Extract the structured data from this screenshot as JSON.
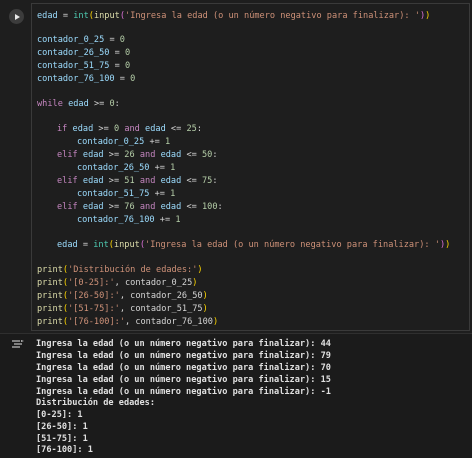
{
  "code": {
    "line1": {
      "var": "edad",
      "eq": " = ",
      "int": "int",
      "input": "input",
      "prompt": "'Ingresa la edad (o un número negativo para finalizar): '"
    },
    "counters": [
      {
        "name": "contador_0_25",
        "eq": " = ",
        "val": "0"
      },
      {
        "name": "contador_26_50",
        "eq": " = ",
        "val": "0"
      },
      {
        "name": "contador_51_75",
        "eq": " = ",
        "val": "0"
      },
      {
        "name": "contador_76_100",
        "eq": " = ",
        "val": "0"
      }
    ],
    "while": {
      "kw": "while",
      "var": "edad",
      "op": " >= ",
      "val": "0",
      "colon": ":"
    },
    "branches": [
      {
        "kw": "if",
        "var1": "edad",
        "op1": " >= ",
        "lo": "0",
        "and": "and",
        "var2": "edad",
        "op2": " <= ",
        "hi": "25",
        "counter": "contador_0_25",
        "inc": " += ",
        "one": "1"
      },
      {
        "kw": "elif",
        "var1": "edad",
        "op1": " >= ",
        "lo": "26",
        "and": "and",
        "var2": "edad",
        "op2": " <= ",
        "hi": "50",
        "counter": "contador_26_50",
        "inc": " += ",
        "one": "1"
      },
      {
        "kw": "elif",
        "var1": "edad",
        "op1": " >= ",
        "lo": "51",
        "and": "and",
        "var2": "edad",
        "op2": " <= ",
        "hi": "75",
        "counter": "contador_51_75",
        "inc": " += ",
        "one": "1"
      },
      {
        "kw": "elif",
        "var1": "edad",
        "op1": " >= ",
        "lo": "76",
        "and": "and",
        "var2": "edad",
        "op2": " <= ",
        "hi": "100",
        "counter": "contador_76_100",
        "inc": " += ",
        "one": "1"
      }
    ],
    "reinput": {
      "var": "edad",
      "eq": " = ",
      "int": "int",
      "input": "input",
      "prompt": "'Ingresa la edad (o un número negativo para finalizar): '"
    },
    "prints": [
      {
        "fn": "print",
        "str": "'Distribución de edades:'",
        "rest": ""
      },
      {
        "fn": "print",
        "str": "'[0-25]:'",
        "rest": ", contador_0_25"
      },
      {
        "fn": "print",
        "str": "'[26-50]:'",
        "rest": ", contador_26_50"
      },
      {
        "fn": "print",
        "str": "'[51-75]:'",
        "rest": ", contador_51_75"
      },
      {
        "fn": "print",
        "str": "'[76-100]:'",
        "rest": ", contador_76_100"
      }
    ]
  },
  "output": {
    "lines": [
      "Ingresa la edad (o un número negativo para finalizar): 44",
      "Ingresa la edad (o un número negativo para finalizar): 79",
      "Ingresa la edad (o un número negativo para finalizar): 70",
      "Ingresa la edad (o un número negativo para finalizar): 15",
      "Ingresa la edad (o un número negativo para finalizar): -1",
      "Distribución de edades:",
      "[0-25]: 1",
      "[26-50]: 1",
      "[51-75]: 1",
      "[76-100]: 1"
    ]
  },
  "colors": {
    "background": "#1e1e1e",
    "keyword": "#c586c0",
    "string": "#ce9178",
    "number": "#b5cea8",
    "builtin": "#4ec9b0",
    "function": "#dcdcaa",
    "variable": "#9cdcfe"
  }
}
